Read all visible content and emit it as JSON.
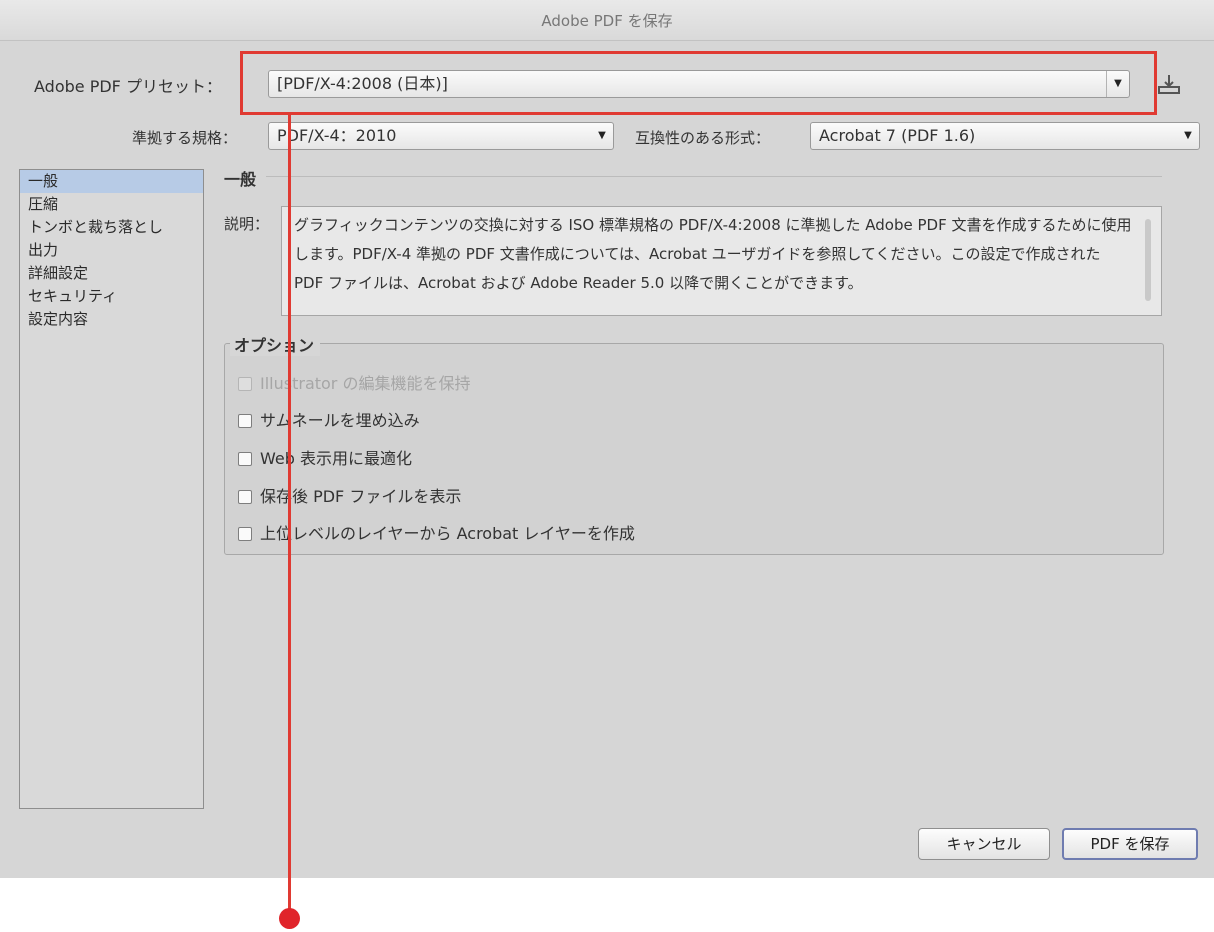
{
  "window": {
    "title": "Adobe PDF を保存"
  },
  "preset": {
    "label": "Adobe PDF プリセット：",
    "value": "[PDF/X-4:2008 (日本)]"
  },
  "standard": {
    "label": "準拠する規格：",
    "value": "PDF/X-4：2010"
  },
  "compatibility": {
    "label": "互換性のある形式：",
    "value": "Acrobat 7 (PDF 1.6)"
  },
  "sidebar": {
    "items": [
      {
        "label": "一般",
        "selected": true
      },
      {
        "label": "圧縮",
        "selected": false
      },
      {
        "label": "トンボと裁ち落とし",
        "selected": false
      },
      {
        "label": "出力",
        "selected": false
      },
      {
        "label": "詳細設定",
        "selected": false
      },
      {
        "label": "セキュリティ",
        "selected": false
      },
      {
        "label": "設定内容",
        "selected": false
      }
    ]
  },
  "general": {
    "heading": "一般",
    "description_label": "説明：",
    "description": "グラフィックコンテンツの交換に対する ISO 標準規格の PDF/X-4:2008 に準拠した Adobe PDF 文書を作成するために使用します。PDF/X-4 準拠の PDF 文書作成については、Acrobat ユーザガイドを参照してください。この設定で作成された PDF ファイルは、Acrobat および Adobe Reader 5.0 以降で開くことができます。"
  },
  "options": {
    "title": "オプション",
    "items": [
      {
        "label": "Illustrator の編集機能を保持",
        "checked": false,
        "enabled": false
      },
      {
        "label": "サムネールを埋め込み",
        "checked": false,
        "enabled": true
      },
      {
        "label": "Web 表示用に最適化",
        "checked": false,
        "enabled": true
      },
      {
        "label": "保存後 PDF ファイルを表示",
        "checked": false,
        "enabled": true
      },
      {
        "label": "上位レベルのレイヤーから Acrobat レイヤーを作成",
        "checked": false,
        "enabled": true
      }
    ]
  },
  "buttons": {
    "cancel": "キャンセル",
    "save": "PDF を保存"
  },
  "icons": {
    "dropdown": "chevron-down-icon",
    "save_preset": "save-preset-icon"
  },
  "colors": {
    "callout": "#e03a32",
    "selection": "#b7cbe6",
    "dialog_bg": "#d6d6d6"
  }
}
